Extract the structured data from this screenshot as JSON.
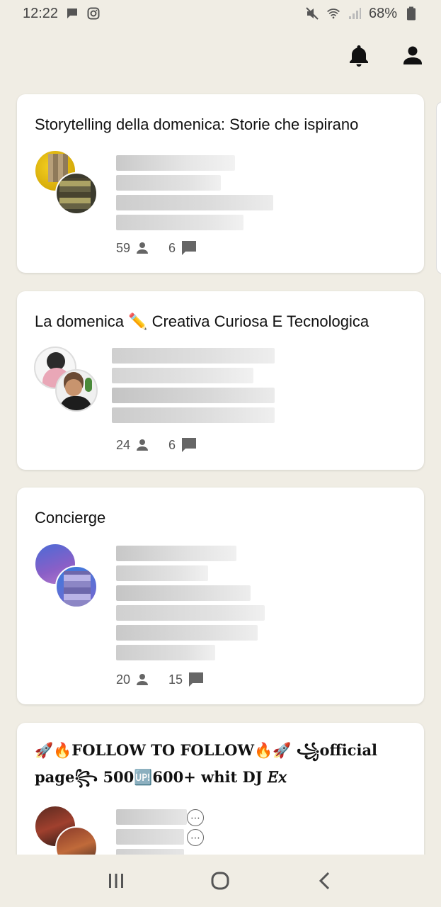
{
  "status_bar": {
    "time": "12:22",
    "battery": "68%",
    "icons": [
      "message-icon",
      "instagram-icon",
      "mute-icon",
      "wifi-icon",
      "signal-icon",
      "battery-icon"
    ]
  },
  "header": {
    "icons": [
      "bell-icon",
      "profile-icon"
    ]
  },
  "cards": [
    {
      "title": "Storytelling della domenica: Storie che ispirano",
      "members": "59",
      "comments": "6"
    },
    {
      "title": "La domenica ✏️ Creativa Curiosa E Tecnologica",
      "members": "24",
      "comments": "6"
    },
    {
      "title": "Concierge 󠀠",
      "members": "20",
      "comments": "15"
    },
    {
      "title_line1": "🚀🔥FOLLOW TO FOLLOW🔥🚀 ꧁official",
      "title_line2": "page꧂ 500🆙600+ whit DJ 𝐸𝑥"
    }
  ],
  "nav_bar": {
    "icons": [
      "recent-apps-icon",
      "home-icon",
      "back-icon"
    ]
  },
  "colors": {
    "background": "#f0ede4",
    "card": "#ffffff",
    "text": "#111111",
    "muted": "#555555"
  }
}
